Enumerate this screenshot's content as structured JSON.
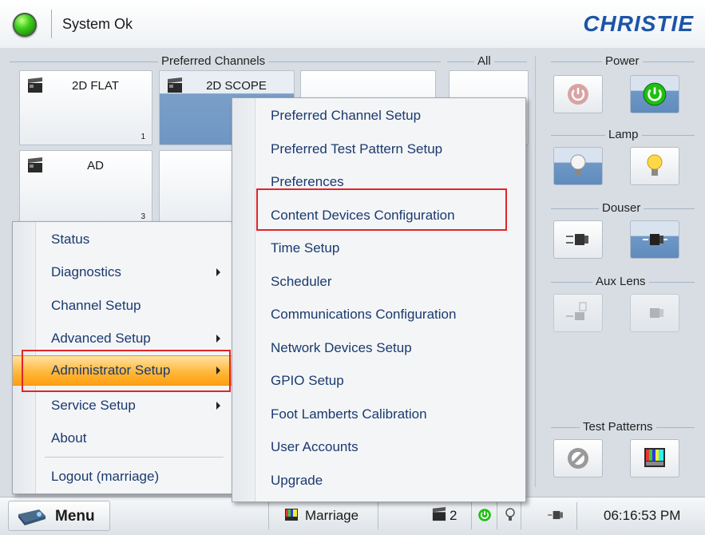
{
  "status": {
    "text": "System Ok",
    "led_color": "#2fcf14"
  },
  "brand": {
    "logo_text": "CHRISTIE"
  },
  "groups": {
    "preferred_channels": "Preferred Channels",
    "all": "All",
    "power": "Power",
    "lamp": "Lamp",
    "douser": "Douser",
    "aux_lens": "Aux Lens",
    "test_patterns": "Test Patterns"
  },
  "channels": [
    {
      "label": "2D FLAT",
      "number": "1",
      "selected": false
    },
    {
      "label": "2D SCOPE",
      "number": "",
      "selected": true
    },
    {
      "label": "AD",
      "number": "3",
      "selected": false
    }
  ],
  "main_menu": {
    "items": [
      {
        "label": "Status",
        "submenu": false
      },
      {
        "label": "Diagnostics",
        "submenu": true
      },
      {
        "label": "Channel Setup",
        "submenu": false
      },
      {
        "label": "Advanced Setup",
        "submenu": true
      },
      {
        "label": "Administrator Setup",
        "submenu": true,
        "highlighted": true
      },
      {
        "label": "Service Setup",
        "submenu": true
      },
      {
        "label": "About",
        "submenu": false
      },
      {
        "label": "Logout (marriage)",
        "submenu": false
      }
    ]
  },
  "admin_submenu": {
    "items": [
      {
        "label": "Preferred Channel Setup"
      },
      {
        "label": "Preferred Test Pattern Setup"
      },
      {
        "label": "Preferences"
      },
      {
        "label": "Content Devices Configuration",
        "boxed": true
      },
      {
        "label": "Time Setup"
      },
      {
        "label": "Scheduler"
      },
      {
        "label": "Communications Configuration"
      },
      {
        "label": "Network Devices Setup"
      },
      {
        "label": "GPIO Setup"
      },
      {
        "label": "Foot Lamberts Calibration"
      },
      {
        "label": "User Accounts"
      },
      {
        "label": "Upgrade"
      }
    ]
  },
  "bottombar": {
    "menu_label": "Menu",
    "user": "Marriage",
    "channel_count": "2",
    "time": "06:16:53 PM"
  },
  "colors": {
    "accent": "#1b55a8",
    "highlight": "#ffb83b",
    "annotation": "#e0262a"
  }
}
